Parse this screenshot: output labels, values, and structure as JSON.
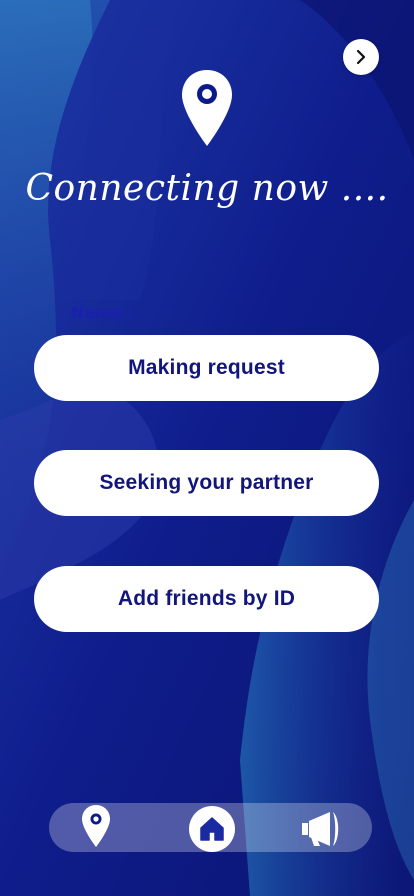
{
  "header": {
    "title": "Connecting now ....",
    "next_icon": "chevron-right-icon",
    "pin_icon": "location-pin-icon"
  },
  "form": {
    "name_label": "Name :"
  },
  "actions": [
    {
      "label": "Making request"
    },
    {
      "label": "Seeking your partner"
    },
    {
      "label": "Add friends by ID"
    }
  ],
  "tabbar": {
    "items": [
      {
        "icon": "location-pin-icon"
      },
      {
        "icon": "home-icon",
        "selected": true
      },
      {
        "icon": "megaphone-icon"
      }
    ]
  },
  "colors": {
    "background": "#0d1a8a",
    "button_text": "#12157a",
    "name_label": "#1a1fb0",
    "white": "#ffffff"
  }
}
